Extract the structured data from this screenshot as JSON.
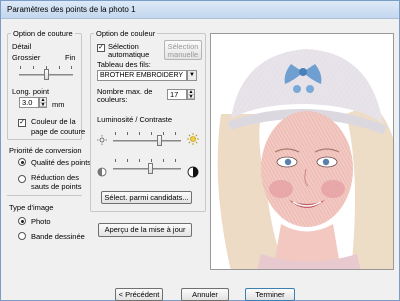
{
  "window": {
    "title": "Paramètres des points de la photo 1"
  },
  "stitch_options": {
    "legend": "Option de couture",
    "detail_label": "Détail",
    "coarse_label": "Grossier",
    "fine_label": "Fin",
    "stitch_length_label": "Long. point",
    "stitch_length_value": "3.0",
    "stitch_length_unit": "mm",
    "page_color_label_line1": "Couleur de la",
    "page_color_label_line2": "page de couture",
    "page_color_checked": true
  },
  "conversion_priority": {
    "title": "Priorité de conversion",
    "options": [
      "Qualité des points",
      "Réduction des",
      "sauts de points"
    ],
    "selected": 0
  },
  "image_type": {
    "title": "Type d'image",
    "options": [
      "Photo",
      "Bande dessinée"
    ],
    "selected": 0
  },
  "color_options": {
    "legend": "Option de couleur",
    "auto_select_line1": "Sélection",
    "auto_select_line2": "automatique",
    "auto_select_checked": true,
    "manual_select_line1": "Sélection",
    "manual_select_line2": "manuelle",
    "thread_table_label": "Tableau des fils:",
    "thread_table_value": "BROTHER EMBROIDERY",
    "max_colors_label_line1": "Nombre max. de",
    "max_colors_label_line2": "couleurs:",
    "max_colors_value": "17",
    "brightness_contrast_label": "Luminosité / Contraste",
    "select_candidates_label": "Sélect. parmi candidats..."
  },
  "update_preview_label": "Aperçu de la mise à jour",
  "footer": {
    "previous_label": "< Précédent",
    "cancel_label": "Annuler",
    "finish_label": "Terminer"
  },
  "colors": {
    "title_bar": "#c4d7ee",
    "panel_bg": "#f0f0f0",
    "beanie": "#e6e4ea",
    "bow": "#6f9fd0"
  }
}
